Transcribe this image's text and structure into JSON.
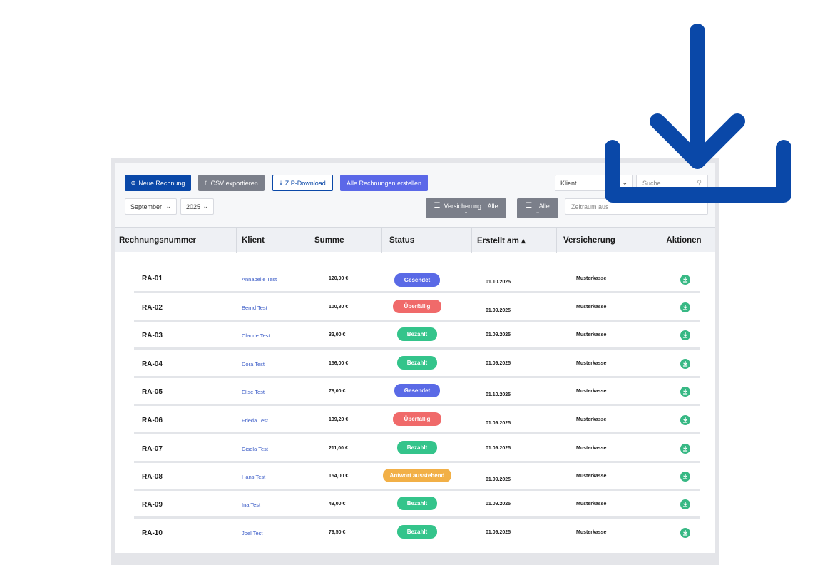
{
  "colors": {
    "primary": "#0a48a8",
    "gray": "#7b7f8a",
    "indigo": "#5b68e8",
    "sent": "#5a6ae6",
    "overdue": "#f06a6a",
    "paid": "#34c48b",
    "pending": "#f2b047",
    "download": "#37b884",
    "overlay_icon": "#0a48a8"
  },
  "toolbar": {
    "new_invoice": "Neue Rechnung",
    "csv_export": "CSV exportieren",
    "zip_download": "ZIP-Download",
    "create_all": "Alle Rechnungen erstellen",
    "month": "September",
    "year": "2025",
    "client_select": "Klient",
    "search_placeholder": "Suche",
    "filter_insurance_label": "Versicherung",
    "filter_insurance_value": ": Alle",
    "filter_second_value": ": Alle",
    "date_range_placeholder": "Zeitraum aus"
  },
  "table": {
    "headers": [
      "Rechnungsnummer",
      "Klient",
      "Summe",
      "Status",
      "Erstellt am ▴",
      "Versicherung",
      "Aktionen"
    ],
    "rows": [
      {
        "num": "RA-01",
        "client": "Annabelle Test",
        "sum": "120,00 €",
        "status": "Gesendet",
        "kind": "sent",
        "date": "01.10.2025",
        "ins": "Musterkasse"
      },
      {
        "num": "RA-02",
        "client": "Bernd Test",
        "sum": "100,80 €",
        "status": "Überfällig",
        "kind": "overdue",
        "date": "01.09.2025",
        "ins": "Musterkasse"
      },
      {
        "num": "RA-03",
        "client": "Claude Test",
        "sum": "32,00 €",
        "status": "Bezahlt",
        "kind": "paid",
        "date": "01.09.2025",
        "ins": "Musterkasse"
      },
      {
        "num": "RA-04",
        "client": "Dora Test",
        "sum": "156,00 €",
        "status": "Bezahlt",
        "kind": "paid",
        "date": "01.09.2025",
        "ins": "Musterkasse"
      },
      {
        "num": "RA-05",
        "client": "Elise Test",
        "sum": "78,00 €",
        "status": "Gesendet",
        "kind": "sent",
        "date": "01.10.2025",
        "ins": "Musterkasse"
      },
      {
        "num": "RA-06",
        "client": "Frieda Test",
        "sum": "139,20 €",
        "status": "Überfällig",
        "kind": "overdue",
        "date": "01.09.2025",
        "ins": "Musterkasse"
      },
      {
        "num": "RA-07",
        "client": "Gisela Test",
        "sum": "211,00 €",
        "status": "Bezahlt",
        "kind": "paid",
        "date": "01.09.2025",
        "ins": "Musterkasse"
      },
      {
        "num": "RA-08",
        "client": "Hans Test",
        "sum": "154,00 €",
        "status": "Antwort ausstehend",
        "kind": "pending",
        "date": "01.09.2025",
        "ins": "Musterkasse"
      },
      {
        "num": "RA-09",
        "client": "Ina Test",
        "sum": "43,00 €",
        "status": "Bezahlt",
        "kind": "paid",
        "date": "01.09.2025",
        "ins": "Musterkasse"
      },
      {
        "num": "RA-10",
        "client": "Joel Test",
        "sum": "79,50 €",
        "status": "Bezahlt",
        "kind": "paid",
        "date": "01.09.2025",
        "ins": "Musterkasse"
      }
    ]
  }
}
